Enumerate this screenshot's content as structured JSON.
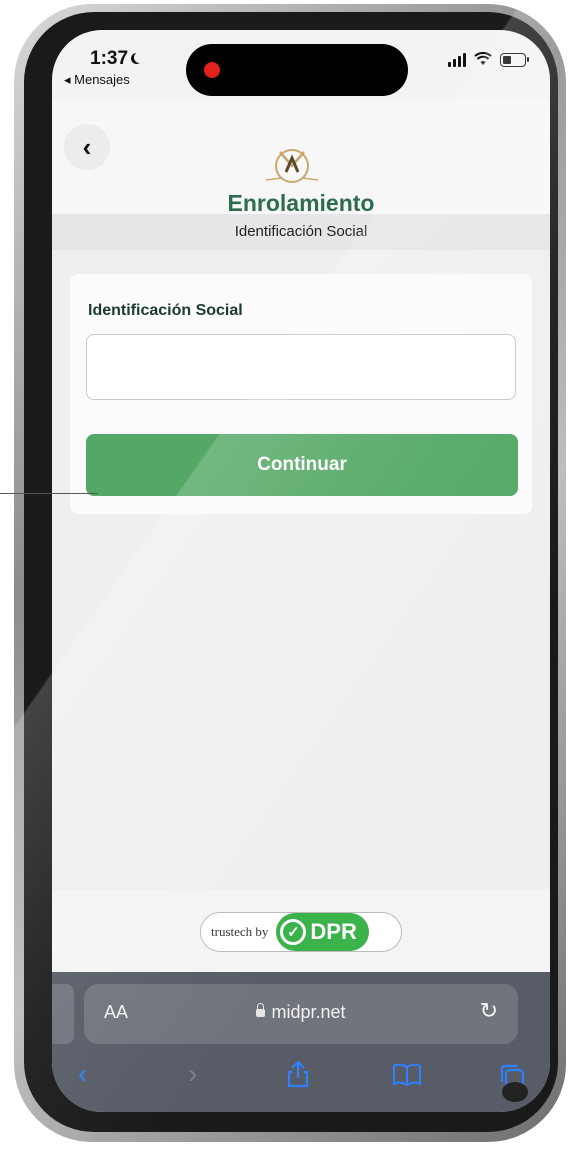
{
  "status_bar": {
    "time": "1:37",
    "back_app": "◂ Mensajes",
    "moon_icon": "moon-icon",
    "signal_icon": "cellular-signal-icon",
    "wifi_icon": "wifi-icon",
    "battery_icon": "battery-icon"
  },
  "header": {
    "back_icon": "chevron-left-icon",
    "back_glyph": "‹",
    "title": "Enrolamiento",
    "progress_fraction": 0.25,
    "step_title": "Identificación Social"
  },
  "form": {
    "field_label": "Identificación Social",
    "field_value": "",
    "continue_label": "Continuar"
  },
  "footer": {
    "brand_prefix": "trustech by",
    "brand_name": "DPR",
    "check_glyph": "✓"
  },
  "browser": {
    "text_size_label": "AA",
    "url": "midpr.net",
    "reload_glyph": "↻",
    "back_glyph": "‹",
    "forward_glyph": "›",
    "share_glyph": "⇪",
    "bookmarks_glyph": "📖",
    "tabs_glyph": "⧉"
  },
  "colors": {
    "accent_green": "#53a865",
    "title_green": "#2f6c4f",
    "safari_blue": "#2f80ff"
  }
}
